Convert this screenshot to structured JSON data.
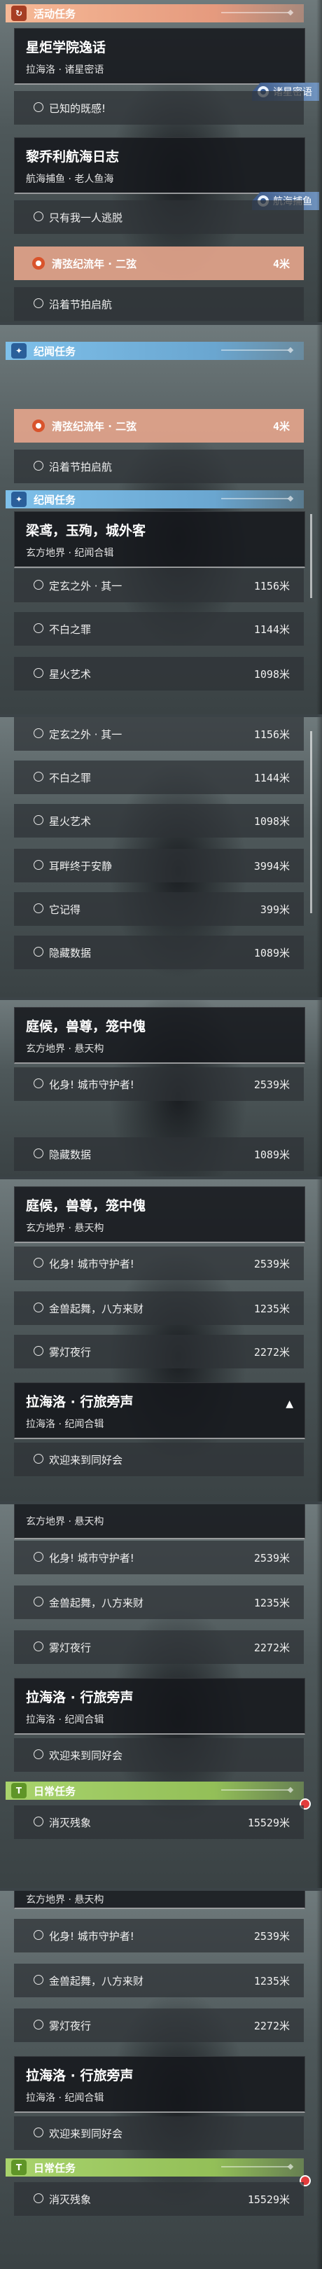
{
  "categories": {
    "activity": "活动任务",
    "plot": "纪闻任务",
    "daily": "日常任务"
  },
  "icons": {
    "activity": "activity-quest-icon",
    "plot": "chronicle-quest-icon",
    "daily": "daily-quest-icon"
  },
  "tags": {
    "xingju": "诸星密语",
    "hanghai": "航海捕鱼"
  },
  "quests": {
    "xingju": {
      "title": "星炬学院逸话",
      "sub": "拉海洛 · 诸星密语",
      "rows": [
        "已知的既感!"
      ]
    },
    "hanghai": {
      "title": "黎乔利航海日志",
      "sub": "航海捕鱼 · 老人鱼海",
      "rows": [
        "只有我一人逃脱",
        "清弦纪流年 · 二弦",
        "沿着节拍启航"
      ],
      "dist": "4米"
    },
    "liangchao": {
      "title": "梁鸢，玉殉，城外客",
      "sub": "玄方地界 · 纪闻合辑",
      "rows": [
        {
          "label": "定玄之外 · 其一",
          "dist": "1156米"
        },
        {
          "label": "不白之罪",
          "dist": "1144米"
        },
        {
          "label": "星火艺术",
          "dist": "1098米"
        },
        {
          "label": "耳畔终于安静",
          "dist": "3994米"
        },
        {
          "label": "它记得",
          "dist": "399米"
        },
        {
          "label": "隐藏数据",
          "dist": "1089米"
        }
      ]
    },
    "tinghou": {
      "title": "庭候，兽尊，笼中傀",
      "sub": "玄方地界 · 悬天构",
      "rows": [
        {
          "label": "化身! 城市守护者!",
          "dist": "2539米"
        },
        {
          "label": "金兽起舞，八方来财",
          "dist": "1235米"
        },
        {
          "label": "雾灯夜行",
          "dist": "2272米"
        }
      ]
    },
    "lahailuo": {
      "title": "拉海洛 · 行旅旁声",
      "sub": "拉海洛 · 纪闻合辑",
      "rows": [
        "欢迎来到同好会"
      ]
    },
    "daily": {
      "rows": [
        {
          "label": "消灭残象",
          "dist": "15529米"
        }
      ]
    }
  }
}
